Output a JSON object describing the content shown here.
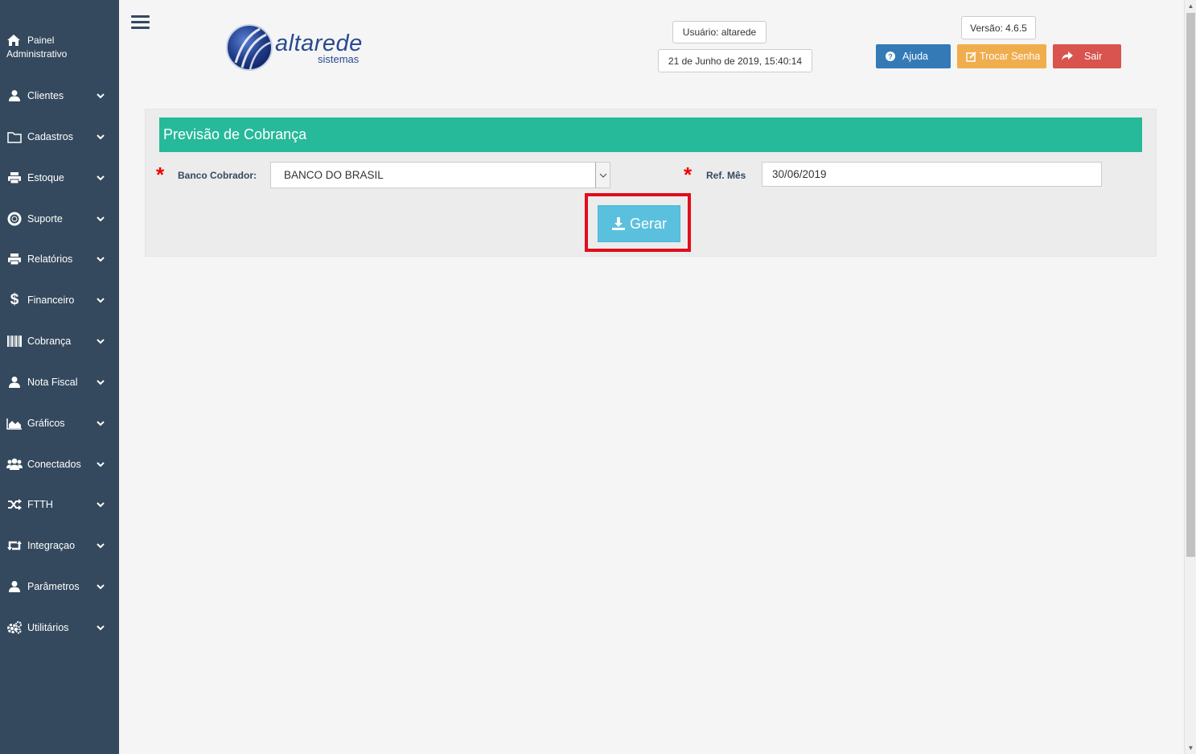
{
  "sidebar": {
    "home": {
      "line1": "Painel",
      "line2": "Administrativo",
      "icon": "home-icon"
    },
    "items": [
      {
        "label": "Clientes",
        "icon": "user-icon"
      },
      {
        "label": "Cadastros",
        "icon": "folder-icon"
      },
      {
        "label": "Estoque",
        "icon": "print-icon"
      },
      {
        "label": "Suporte",
        "icon": "lifebuoy-icon"
      },
      {
        "label": "Relatórios",
        "icon": "print-icon"
      },
      {
        "label": "Financeiro",
        "icon": "dollar-icon"
      },
      {
        "label": "Cobrança",
        "icon": "barcode-icon"
      },
      {
        "label": "Nota Fiscal",
        "icon": "user-icon"
      },
      {
        "label": "Gráficos",
        "icon": "area-chart-icon"
      },
      {
        "label": "Conectados",
        "icon": "users-icon"
      },
      {
        "label": "FTTH",
        "icon": "random-icon"
      },
      {
        "label": "Integraçao",
        "icon": "retweet-icon"
      },
      {
        "label": "Parâmetros",
        "icon": "user-icon"
      },
      {
        "label": "Utilitários",
        "icon": "gears-icon"
      }
    ]
  },
  "header": {
    "logo": {
      "word": "altarede",
      "sub": "sistemas"
    },
    "user": "Usuário: altarede",
    "datetime": "21 de Junho de 2019, 15:40:14",
    "version": "Versão: 4.6.5",
    "help_label": "Ajuda",
    "change_password_label": "Trocar Senha",
    "exit_label": "Sair"
  },
  "panel": {
    "title": "Previsão de Cobrança",
    "bank_label": "Banco Cobrador:",
    "bank_value": "BANCO DO BRASIL",
    "ref_label": "Ref. Mês",
    "ref_value": "30/06/2019",
    "generate_label": "Gerar"
  },
  "colors": {
    "sidebar": "#34495e",
    "panel_title": "#26b99a",
    "help": "#337ab7",
    "password": "#f0ad4e",
    "exit": "#d9534f",
    "generate": "#5bc0de",
    "highlight": "#e00d1d"
  }
}
